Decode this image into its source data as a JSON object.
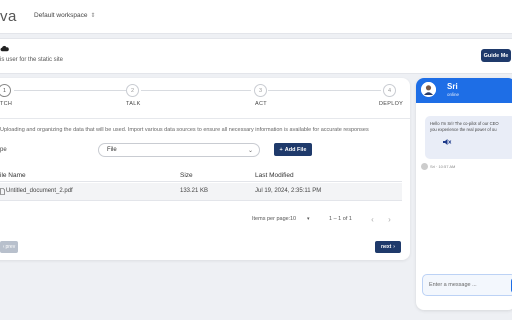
{
  "header": {
    "brand": "va",
    "workspace": "Default workspace"
  },
  "subheader": {
    "text": "is user for the static site",
    "guide_label": "Guide Me"
  },
  "stepper": {
    "steps": [
      {
        "number": "1",
        "label": "TCH"
      },
      {
        "number": "2",
        "label": "TALK"
      },
      {
        "number": "3",
        "label": "ACT"
      },
      {
        "number": "4",
        "label": "DEPLOY"
      }
    ]
  },
  "main": {
    "description": "Uploading and organizing the data that will be used. Import various data sources to ensure all necessary information is available for accurate responses",
    "type_label": "pe",
    "select_value": "File",
    "add_file_label": "Add File"
  },
  "table": {
    "columns": [
      "ile Name",
      "Size",
      "Last Modified"
    ],
    "rows": [
      {
        "name": "Untitled_document_2.pdf",
        "size": "133.21 KB",
        "modified": "Jul 19, 2024, 2:35:11 PM"
      }
    ]
  },
  "pagination": {
    "items_per_page_label": "Items per page:",
    "items_per_page_value": "10",
    "range": "1 – 1 of 1"
  },
  "nav": {
    "prev_label": "prev",
    "next_label": "next"
  },
  "chat": {
    "name": "Sri",
    "status": "online",
    "message_line1": "Hello I'm Sri! The co-pilot of our CEO",
    "message_line2": "you experience the real power of ou",
    "meta": "Sri · 10:57 AM",
    "input_placeholder": "Enter a message ...",
    "header_color": "#1e6ee6"
  },
  "colors": {
    "primary_button": "#1f3a6b",
    "disabled_button": "#b8c0cc"
  }
}
